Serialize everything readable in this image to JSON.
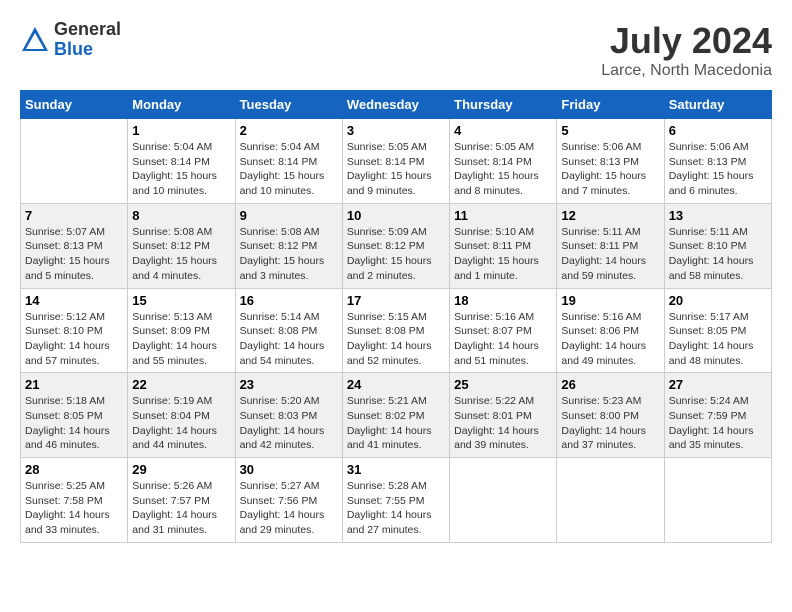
{
  "header": {
    "logo_general": "General",
    "logo_blue": "Blue",
    "month_title": "July 2024",
    "location": "Larce, North Macedonia"
  },
  "days_of_week": [
    "Sunday",
    "Monday",
    "Tuesday",
    "Wednesday",
    "Thursday",
    "Friday",
    "Saturday"
  ],
  "weeks": [
    [
      {
        "day": "",
        "info": ""
      },
      {
        "day": "1",
        "info": "Sunrise: 5:04 AM\nSunset: 8:14 PM\nDaylight: 15 hours\nand 10 minutes."
      },
      {
        "day": "2",
        "info": "Sunrise: 5:04 AM\nSunset: 8:14 PM\nDaylight: 15 hours\nand 10 minutes."
      },
      {
        "day": "3",
        "info": "Sunrise: 5:05 AM\nSunset: 8:14 PM\nDaylight: 15 hours\nand 9 minutes."
      },
      {
        "day": "4",
        "info": "Sunrise: 5:05 AM\nSunset: 8:14 PM\nDaylight: 15 hours\nand 8 minutes."
      },
      {
        "day": "5",
        "info": "Sunrise: 5:06 AM\nSunset: 8:13 PM\nDaylight: 15 hours\nand 7 minutes."
      },
      {
        "day": "6",
        "info": "Sunrise: 5:06 AM\nSunset: 8:13 PM\nDaylight: 15 hours\nand 6 minutes."
      }
    ],
    [
      {
        "day": "7",
        "info": "Sunrise: 5:07 AM\nSunset: 8:13 PM\nDaylight: 15 hours\nand 5 minutes."
      },
      {
        "day": "8",
        "info": "Sunrise: 5:08 AM\nSunset: 8:12 PM\nDaylight: 15 hours\nand 4 minutes."
      },
      {
        "day": "9",
        "info": "Sunrise: 5:08 AM\nSunset: 8:12 PM\nDaylight: 15 hours\nand 3 minutes."
      },
      {
        "day": "10",
        "info": "Sunrise: 5:09 AM\nSunset: 8:12 PM\nDaylight: 15 hours\nand 2 minutes."
      },
      {
        "day": "11",
        "info": "Sunrise: 5:10 AM\nSunset: 8:11 PM\nDaylight: 15 hours\nand 1 minute."
      },
      {
        "day": "12",
        "info": "Sunrise: 5:11 AM\nSunset: 8:11 PM\nDaylight: 14 hours\nand 59 minutes."
      },
      {
        "day": "13",
        "info": "Sunrise: 5:11 AM\nSunset: 8:10 PM\nDaylight: 14 hours\nand 58 minutes."
      }
    ],
    [
      {
        "day": "14",
        "info": "Sunrise: 5:12 AM\nSunset: 8:10 PM\nDaylight: 14 hours\nand 57 minutes."
      },
      {
        "day": "15",
        "info": "Sunrise: 5:13 AM\nSunset: 8:09 PM\nDaylight: 14 hours\nand 55 minutes."
      },
      {
        "day": "16",
        "info": "Sunrise: 5:14 AM\nSunset: 8:08 PM\nDaylight: 14 hours\nand 54 minutes."
      },
      {
        "day": "17",
        "info": "Sunrise: 5:15 AM\nSunset: 8:08 PM\nDaylight: 14 hours\nand 52 minutes."
      },
      {
        "day": "18",
        "info": "Sunrise: 5:16 AM\nSunset: 8:07 PM\nDaylight: 14 hours\nand 51 minutes."
      },
      {
        "day": "19",
        "info": "Sunrise: 5:16 AM\nSunset: 8:06 PM\nDaylight: 14 hours\nand 49 minutes."
      },
      {
        "day": "20",
        "info": "Sunrise: 5:17 AM\nSunset: 8:05 PM\nDaylight: 14 hours\nand 48 minutes."
      }
    ],
    [
      {
        "day": "21",
        "info": "Sunrise: 5:18 AM\nSunset: 8:05 PM\nDaylight: 14 hours\nand 46 minutes."
      },
      {
        "day": "22",
        "info": "Sunrise: 5:19 AM\nSunset: 8:04 PM\nDaylight: 14 hours\nand 44 minutes."
      },
      {
        "day": "23",
        "info": "Sunrise: 5:20 AM\nSunset: 8:03 PM\nDaylight: 14 hours\nand 42 minutes."
      },
      {
        "day": "24",
        "info": "Sunrise: 5:21 AM\nSunset: 8:02 PM\nDaylight: 14 hours\nand 41 minutes."
      },
      {
        "day": "25",
        "info": "Sunrise: 5:22 AM\nSunset: 8:01 PM\nDaylight: 14 hours\nand 39 minutes."
      },
      {
        "day": "26",
        "info": "Sunrise: 5:23 AM\nSunset: 8:00 PM\nDaylight: 14 hours\nand 37 minutes."
      },
      {
        "day": "27",
        "info": "Sunrise: 5:24 AM\nSunset: 7:59 PM\nDaylight: 14 hours\nand 35 minutes."
      }
    ],
    [
      {
        "day": "28",
        "info": "Sunrise: 5:25 AM\nSunset: 7:58 PM\nDaylight: 14 hours\nand 33 minutes."
      },
      {
        "day": "29",
        "info": "Sunrise: 5:26 AM\nSunset: 7:57 PM\nDaylight: 14 hours\nand 31 minutes."
      },
      {
        "day": "30",
        "info": "Sunrise: 5:27 AM\nSunset: 7:56 PM\nDaylight: 14 hours\nand 29 minutes."
      },
      {
        "day": "31",
        "info": "Sunrise: 5:28 AM\nSunset: 7:55 PM\nDaylight: 14 hours\nand 27 minutes."
      },
      {
        "day": "",
        "info": ""
      },
      {
        "day": "",
        "info": ""
      },
      {
        "day": "",
        "info": ""
      }
    ]
  ]
}
